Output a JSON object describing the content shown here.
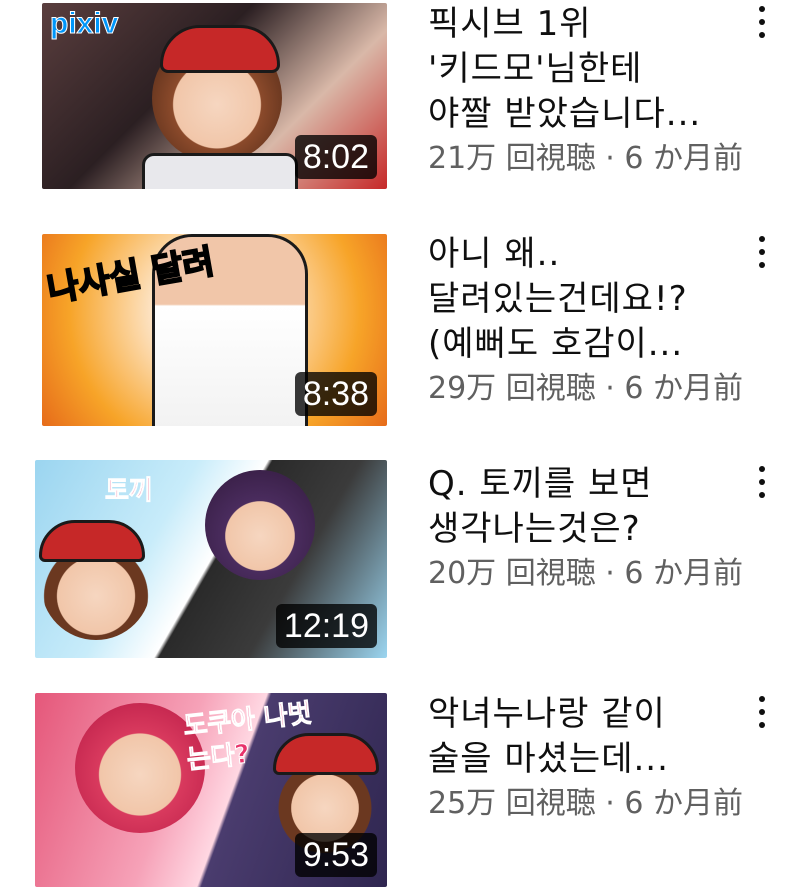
{
  "videos": [
    {
      "title_lines": [
        "픽시브 1위",
        "'키드모'님한테",
        "야짤 받았습니다..."
      ],
      "views": "21万 回視聴",
      "age": "6 か月前",
      "duration": "8:02",
      "thumb_overlay": "pixiv",
      "colors": {
        "bg1": "#3a2a2e",
        "bg2": "#c8a89a",
        "accent": "#c62828"
      }
    },
    {
      "title_lines": [
        "아니 왜..",
        "달려있는건데요!?",
        "(예뻐도 호감이..."
      ],
      "views": "29万 回視聴",
      "age": "6 か月前",
      "duration": "8:38",
      "thumb_overlay": "나사실 달려",
      "colors": {
        "bg1": "#f7a428",
        "bg2": "#fde3c4",
        "accent": "#e66b1a"
      }
    },
    {
      "title_lines": [
        "Q. 토끼를 보면",
        "생각나는것은?"
      ],
      "views": "20万 回視聴",
      "age": "6 か月前",
      "duration": "12:19",
      "thumb_overlay": "토끼",
      "colors": {
        "bg1": "#9bd5f0",
        "bg2": "#2a2a2a",
        "accent": "#c62828"
      }
    },
    {
      "title_lines": [
        "악녀누나랑 같이",
        "술을 마셨는데..."
      ],
      "views": "25万 回視聴",
      "age": "6 か月前",
      "duration": "9:53",
      "thumb_overlay": "도쿠아 나벗는다?",
      "colors": {
        "bg1": "#e5577a",
        "bg2": "#4a3c6e",
        "accent": "#c62828"
      }
    }
  ],
  "meta_separator": " · "
}
